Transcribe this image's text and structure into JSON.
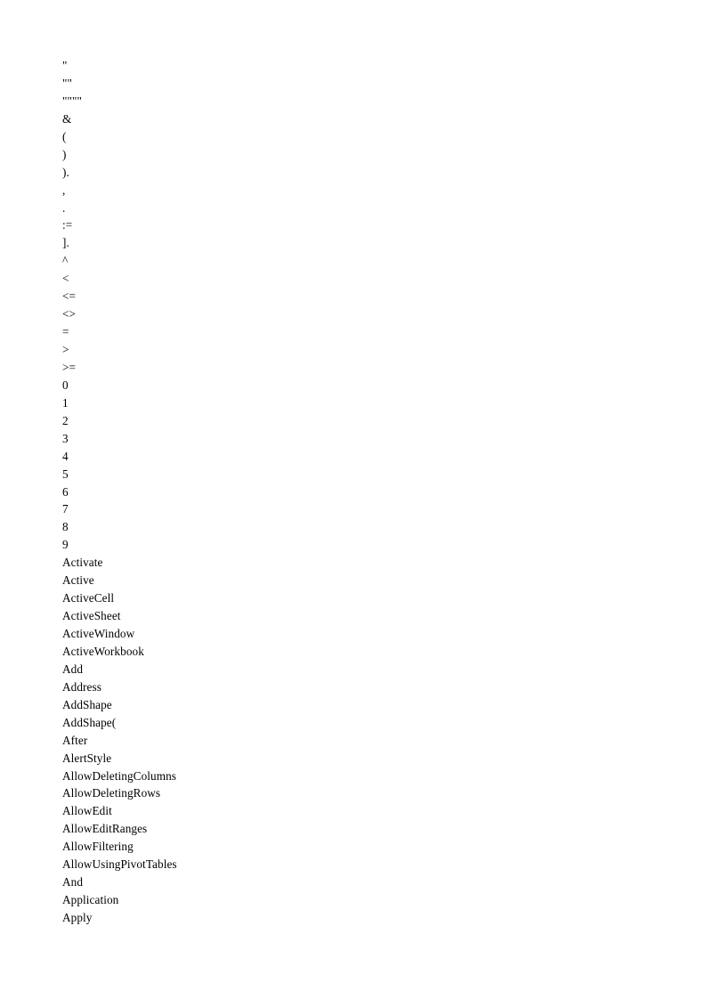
{
  "document": {
    "page_background": "#ffffff",
    "text_color": "#000000",
    "token_list": [
      "\"",
      "\"\"",
      "\"\"\"\"",
      "&",
      "(",
      ")",
      ").",
      ",",
      ".",
      ":=",
      "].",
      "^",
      "<",
      "<=",
      "<>",
      "=",
      ">",
      ">=",
      "0",
      "1",
      "2",
      "3",
      "4",
      "5",
      "6",
      "7",
      "8",
      "9",
      "Activate",
      "Active",
      "ActiveCell",
      "ActiveSheet",
      "ActiveWindow",
      "ActiveWorkbook",
      "Add",
      "Address",
      "AddShape",
      "AddShape(",
      "After",
      "AlertStyle",
      "AllowDeletingColumns",
      "AllowDeletingRows",
      "AllowEdit",
      "AllowEditRanges",
      "AllowFiltering",
      "AllowUsingPivotTables",
      "And",
      "Application",
      "Apply"
    ]
  }
}
